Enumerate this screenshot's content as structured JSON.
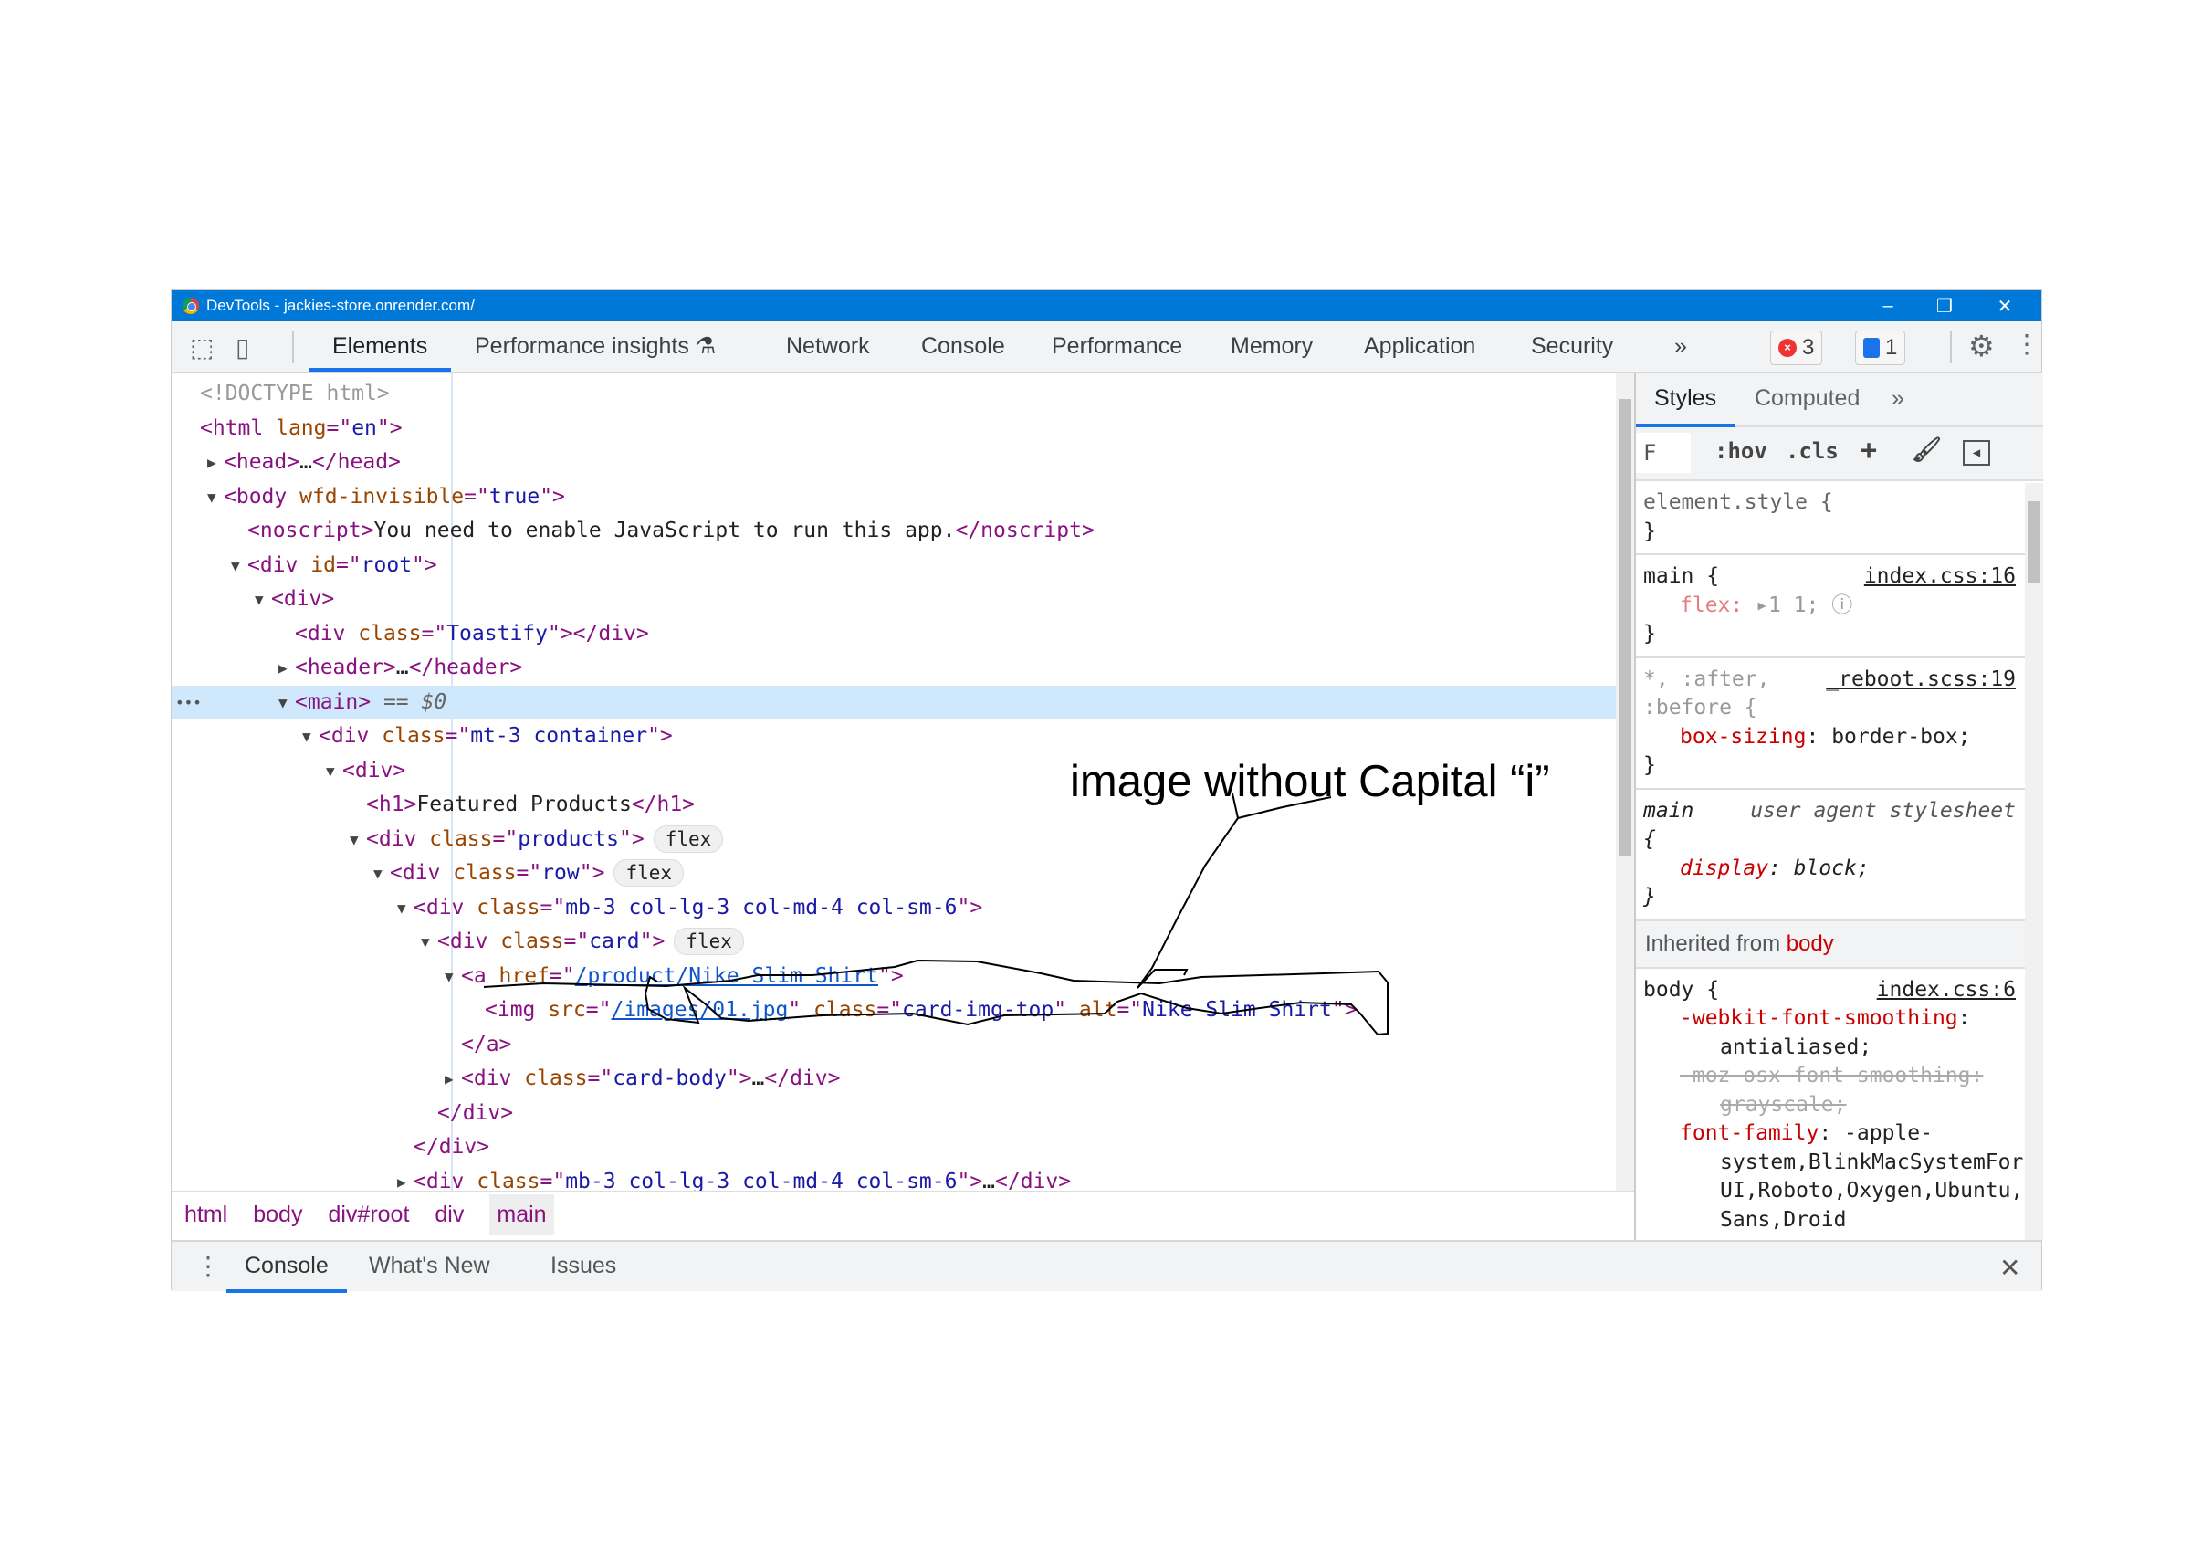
{
  "window": {
    "title": "DevTools - jackies-store.onrender.com/",
    "minimize": "–",
    "restore": "❐",
    "close": "✕"
  },
  "toolbar": {
    "tabs": [
      "Elements",
      "Performance insights",
      "Network",
      "Console",
      "Performance",
      "Memory",
      "Application",
      "Security"
    ],
    "more": "»",
    "errors": "3",
    "messages": "1",
    "active": "Elements"
  },
  "elements": {
    "lines": [
      {
        "indent": 0,
        "tokens": [
          [
            "gray",
            "<!DOCTYPE html>"
          ]
        ]
      },
      {
        "indent": 0,
        "tokens": [
          [
            "tag",
            "<html "
          ],
          [
            "attr",
            "lang"
          ],
          [
            "tag",
            "=\""
          ],
          [
            "val",
            "en"
          ],
          [
            "tag",
            "\">"
          ]
        ]
      },
      {
        "indent": 1,
        "arrow": "right",
        "tokens": [
          [
            "tag",
            "<head>"
          ],
          [
            "text",
            "…"
          ],
          [
            "tag",
            "</head>"
          ]
        ]
      },
      {
        "indent": 1,
        "arrow": "down",
        "tokens": [
          [
            "tag",
            "<body "
          ],
          [
            "attr",
            "wfd-invisible"
          ],
          [
            "tag",
            "=\""
          ],
          [
            "val",
            "true"
          ],
          [
            "tag",
            "\">"
          ]
        ]
      },
      {
        "indent": 2,
        "tokens": [
          [
            "tag",
            "<noscript>"
          ],
          [
            "text",
            "You need to enable JavaScript to run this app."
          ],
          [
            "tag",
            "</noscript>"
          ]
        ]
      },
      {
        "indent": 2,
        "arrow": "down",
        "tokens": [
          [
            "tag",
            "<div "
          ],
          [
            "attr",
            "id"
          ],
          [
            "tag",
            "=\""
          ],
          [
            "val",
            "root"
          ],
          [
            "tag",
            "\">"
          ]
        ]
      },
      {
        "indent": 3,
        "arrow": "down",
        "tokens": [
          [
            "tag",
            "<div>"
          ]
        ]
      },
      {
        "indent": 4,
        "tokens": [
          [
            "tag",
            "<div "
          ],
          [
            "attr",
            "class"
          ],
          [
            "tag",
            "=\""
          ],
          [
            "val",
            "Toastify"
          ],
          [
            "tag",
            "\"></div>"
          ]
        ]
      },
      {
        "indent": 4,
        "arrow": "right",
        "tokens": [
          [
            "tag",
            "<header>"
          ],
          [
            "text",
            "…"
          ],
          [
            "tag",
            "</header>"
          ]
        ]
      },
      {
        "indent": 4,
        "arrow": "down",
        "selected": true,
        "tokens": [
          [
            "tag",
            "<main>"
          ],
          [
            "sel",
            " == $0"
          ]
        ]
      },
      {
        "indent": 5,
        "arrow": "down",
        "tokens": [
          [
            "tag",
            "<div "
          ],
          [
            "attr",
            "class"
          ],
          [
            "tag",
            "=\""
          ],
          [
            "val",
            "mt-3 container"
          ],
          [
            "tag",
            "\">"
          ]
        ]
      },
      {
        "indent": 6,
        "arrow": "down",
        "tokens": [
          [
            "tag",
            "<div>"
          ]
        ]
      },
      {
        "indent": 7,
        "tokens": [
          [
            "tag",
            "<h1>"
          ],
          [
            "text",
            "Featured Products"
          ],
          [
            "tag",
            "</h1>"
          ]
        ]
      },
      {
        "indent": 7,
        "arrow": "down",
        "badge": "flex",
        "tokens": [
          [
            "tag",
            "<div "
          ],
          [
            "attr",
            "class"
          ],
          [
            "tag",
            "=\""
          ],
          [
            "val",
            "products"
          ],
          [
            "tag",
            "\">"
          ]
        ]
      },
      {
        "indent": 8,
        "arrow": "down",
        "badge": "flex",
        "tokens": [
          [
            "tag",
            "<div "
          ],
          [
            "attr",
            "class"
          ],
          [
            "tag",
            "=\""
          ],
          [
            "val",
            "row"
          ],
          [
            "tag",
            "\">"
          ]
        ]
      },
      {
        "indent": 9,
        "arrow": "down",
        "tokens": [
          [
            "tag",
            "<div "
          ],
          [
            "attr",
            "class"
          ],
          [
            "tag",
            "=\""
          ],
          [
            "val",
            "mb-3 col-lg-3 col-md-4 col-sm-6"
          ],
          [
            "tag",
            "\">"
          ]
        ]
      },
      {
        "indent": 10,
        "arrow": "down",
        "badge": "flex",
        "tokens": [
          [
            "tag",
            "<div "
          ],
          [
            "attr",
            "class"
          ],
          [
            "tag",
            "=\""
          ],
          [
            "val",
            "card"
          ],
          [
            "tag",
            "\">"
          ]
        ]
      },
      {
        "indent": 11,
        "arrow": "down",
        "tokens": [
          [
            "tag",
            "<a "
          ],
          [
            "attr",
            "href"
          ],
          [
            "tag",
            "=\""
          ],
          [
            "link",
            "/product/Nike Slim Shirt"
          ],
          [
            "tag",
            "\">"
          ]
        ]
      },
      {
        "indent": 12,
        "tokens": [
          [
            "tag",
            "<img "
          ],
          [
            "attr",
            "src"
          ],
          [
            "tag",
            "=\""
          ],
          [
            "link",
            "/images/01.jpg"
          ],
          [
            "tag",
            "\" "
          ],
          [
            "attr",
            "class"
          ],
          [
            "tag",
            "=\""
          ],
          [
            "val",
            "card-img-top"
          ],
          [
            "tag",
            "\" "
          ],
          [
            "attr",
            "alt"
          ],
          [
            "tag",
            "=\""
          ],
          [
            "val",
            "Nike Slim Shirt"
          ],
          [
            "tag",
            "\">"
          ]
        ]
      },
      {
        "indent": 11,
        "tokens": [
          [
            "tag",
            "</a>"
          ]
        ]
      },
      {
        "indent": 11,
        "arrow": "right",
        "tokens": [
          [
            "tag",
            "<div "
          ],
          [
            "attr",
            "class"
          ],
          [
            "tag",
            "=\""
          ],
          [
            "val",
            "card-body"
          ],
          [
            "tag",
            "\">"
          ],
          [
            "text",
            "…"
          ],
          [
            "tag",
            "</div>"
          ]
        ]
      },
      {
        "indent": 10,
        "tokens": [
          [
            "tag",
            "</div>"
          ]
        ]
      },
      {
        "indent": 9,
        "tokens": [
          [
            "tag",
            "</div>"
          ]
        ]
      },
      {
        "indent": 9,
        "arrow": "right",
        "tokens": [
          [
            "tag",
            "<div "
          ],
          [
            "attr",
            "class"
          ],
          [
            "tag",
            "=\""
          ],
          [
            "val",
            "mb-3 col-lg-3 col-md-4 col-sm-6"
          ],
          [
            "tag",
            "\">"
          ],
          [
            "text",
            "…"
          ],
          [
            "tag",
            "</div>"
          ]
        ]
      }
    ],
    "dots": "•••"
  },
  "breadcrumbs": [
    "html",
    "body",
    "div#root",
    "div",
    "main"
  ],
  "drawer": {
    "tabs": [
      "Console",
      "What's New",
      "Issues"
    ],
    "close": "✕"
  },
  "styles": {
    "tabs": [
      "Styles",
      "Computed"
    ],
    "more": "»",
    "filter": "F",
    "hov": ":hov",
    "cls": ".cls",
    "plus": "+",
    "element_style": {
      "selector": "element.style {",
      "close": "}"
    },
    "rule_main": {
      "selector": "main {",
      "source": "index.css:16",
      "prop": "flex:",
      "value": "1 1;",
      "close": "}"
    },
    "rule_reboot": {
      "selector1": "*, :after,",
      "selector2": ":before {",
      "source": "_reboot.scss:19",
      "prop": "box-sizing",
      "value": " border-box;",
      "close": "}"
    },
    "rule_ua": {
      "selector": "main",
      "source": "user agent stylesheet",
      "open": "{",
      "prop": "display",
      "value": " block;",
      "close": "}"
    },
    "inherited": {
      "label": "Inherited from ",
      "element": "body"
    },
    "rule_body": {
      "selector": "body {",
      "source": "index.css:6",
      "p1": "-webkit-font-smoothing",
      "v1": "antialiased;",
      "p2": "-moz-osx-font-smoothing:",
      "v2": "grayscale;",
      "p3": "font-family",
      "v3a": " -apple-",
      "v3b": "system,BlinkMacSystemFor",
      "v3c": "UI,Roboto,Oxygen,Ubuntu,",
      "v3d": "Sans,Droid"
    }
  },
  "annotation": {
    "text": "image without Capital “i”"
  },
  "colors": {
    "titlebar": "#0078d7",
    "accent": "#1a73e8",
    "tag": "#881280",
    "attr": "#994500",
    "value": "#1a1aa6",
    "property": "#c80000",
    "selected_row": "#cfe8fc"
  }
}
